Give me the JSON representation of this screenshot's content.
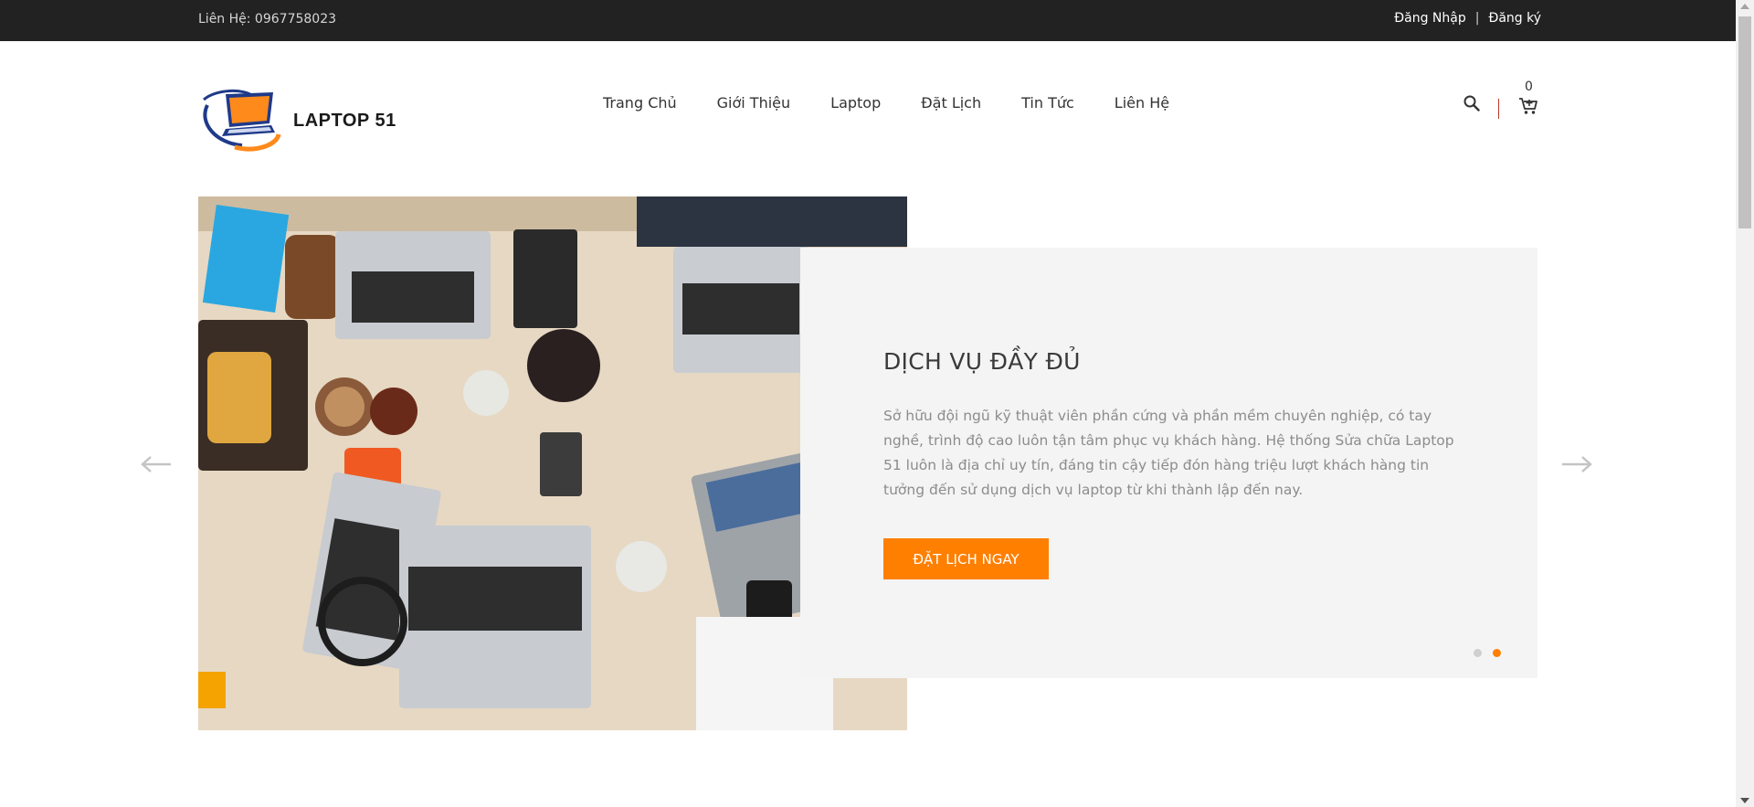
{
  "topbar": {
    "contact": "Liên Hệ: 0967758023",
    "login": "Đăng Nhập",
    "separator": "|",
    "register": "Đăng ký"
  },
  "header": {
    "brand": "LAPTOP 51",
    "cart_count": "0",
    "icons": [
      "search-icon",
      "cart-icon"
    ]
  },
  "nav": {
    "items": [
      {
        "label": "Trang Chủ"
      },
      {
        "label": "Giới Thiệu"
      },
      {
        "label": "Laptop"
      },
      {
        "label": "Đặt Lịch"
      },
      {
        "label": "Tin Tức"
      },
      {
        "label": "Liên Hệ"
      }
    ]
  },
  "slider": {
    "title": "DỊCH VỤ ĐẦY ĐỦ",
    "description": "Sở hữu đội ngũ kỹ thuật viên phần cứng và phần mềm chuyên nghiệp, có tay nghề, trình độ cao luôn tận tâm phục vụ khách hàng. Hệ thống Sửa chữa Laptop 51 luôn là địa chỉ uy tín, đáng tin cậy tiếp đón hàng triệu lượt khách hàng tin tưởng đến sử dụng dịch vụ laptop từ khi thành lập đến nay.",
    "cta_label": "ĐẶT LỊCH NGAY",
    "slide_count": 2,
    "active_slide": 2,
    "icons": [
      "arrow-left-icon",
      "arrow-right-icon"
    ]
  },
  "colors": {
    "accent": "#ff7f00",
    "topbar_bg": "#222222",
    "panel_bg": "#f4f4f4"
  }
}
